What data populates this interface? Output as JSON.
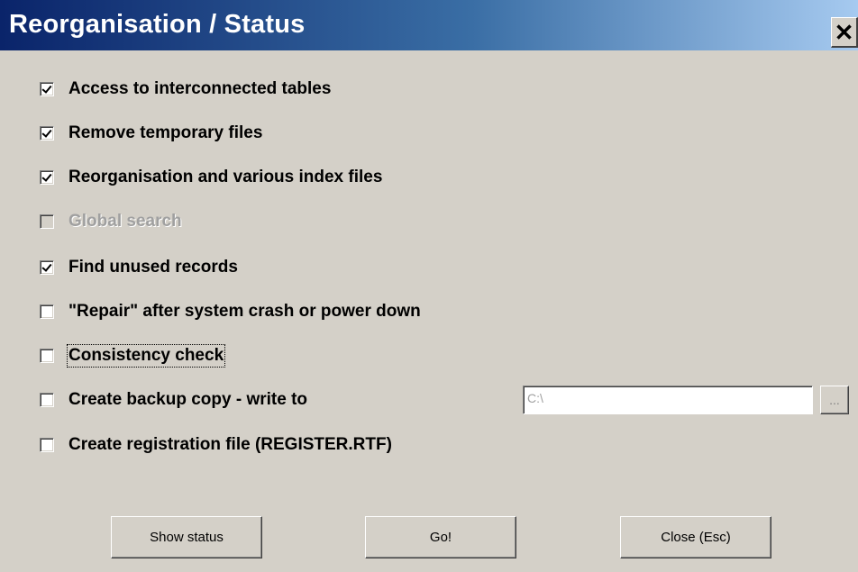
{
  "window": {
    "title": "Reorganisation / Status",
    "close_label": "✕"
  },
  "options": [
    {
      "label": "Access to interconnected tables",
      "checked": true,
      "disabled": false
    },
    {
      "label": "Remove temporary files",
      "checked": true,
      "disabled": false
    },
    {
      "label": "Reorganisation and various index files",
      "checked": true,
      "disabled": false
    },
    {
      "label": "Global search",
      "checked": false,
      "disabled": true
    },
    {
      "label": "Find unused records",
      "checked": true,
      "disabled": false
    },
    {
      "label": "\"Repair\" after system crash or power down",
      "checked": false,
      "disabled": false
    },
    {
      "label": "Consistency check",
      "checked": false,
      "disabled": false,
      "focused": true
    },
    {
      "label": "Create backup copy - write to",
      "checked": false,
      "disabled": false
    },
    {
      "label": "Create registration file (REGISTER.RTF)",
      "checked": false,
      "disabled": false
    }
  ],
  "backup": {
    "path_value": "C:\\",
    "browse_label": "..."
  },
  "buttons": {
    "show_status": "Show status",
    "go": "Go!",
    "close": "Close (Esc)"
  },
  "colors": {
    "title_gradient_start": "#0a246a",
    "title_gradient_end": "#a6caf0",
    "dialog_face": "#d4d0c8"
  }
}
